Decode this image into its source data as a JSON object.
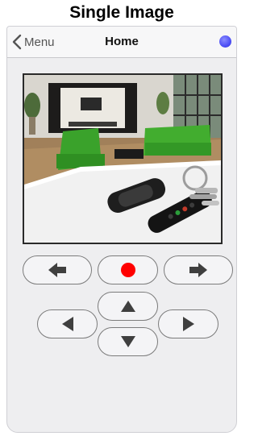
{
  "caption": "Single Image",
  "navbar": {
    "back_label": "Menu",
    "title": "Home",
    "status_color": "#4d4ff5"
  },
  "camera": {
    "description_icon": "camera-image"
  },
  "controls": {
    "record_color": "#ff0000",
    "buttons": [
      "previous-icon",
      "record-icon",
      "next-icon",
      "pan-left-icon",
      "tilt-up-icon",
      "tilt-down-icon",
      "pan-right-icon"
    ]
  }
}
